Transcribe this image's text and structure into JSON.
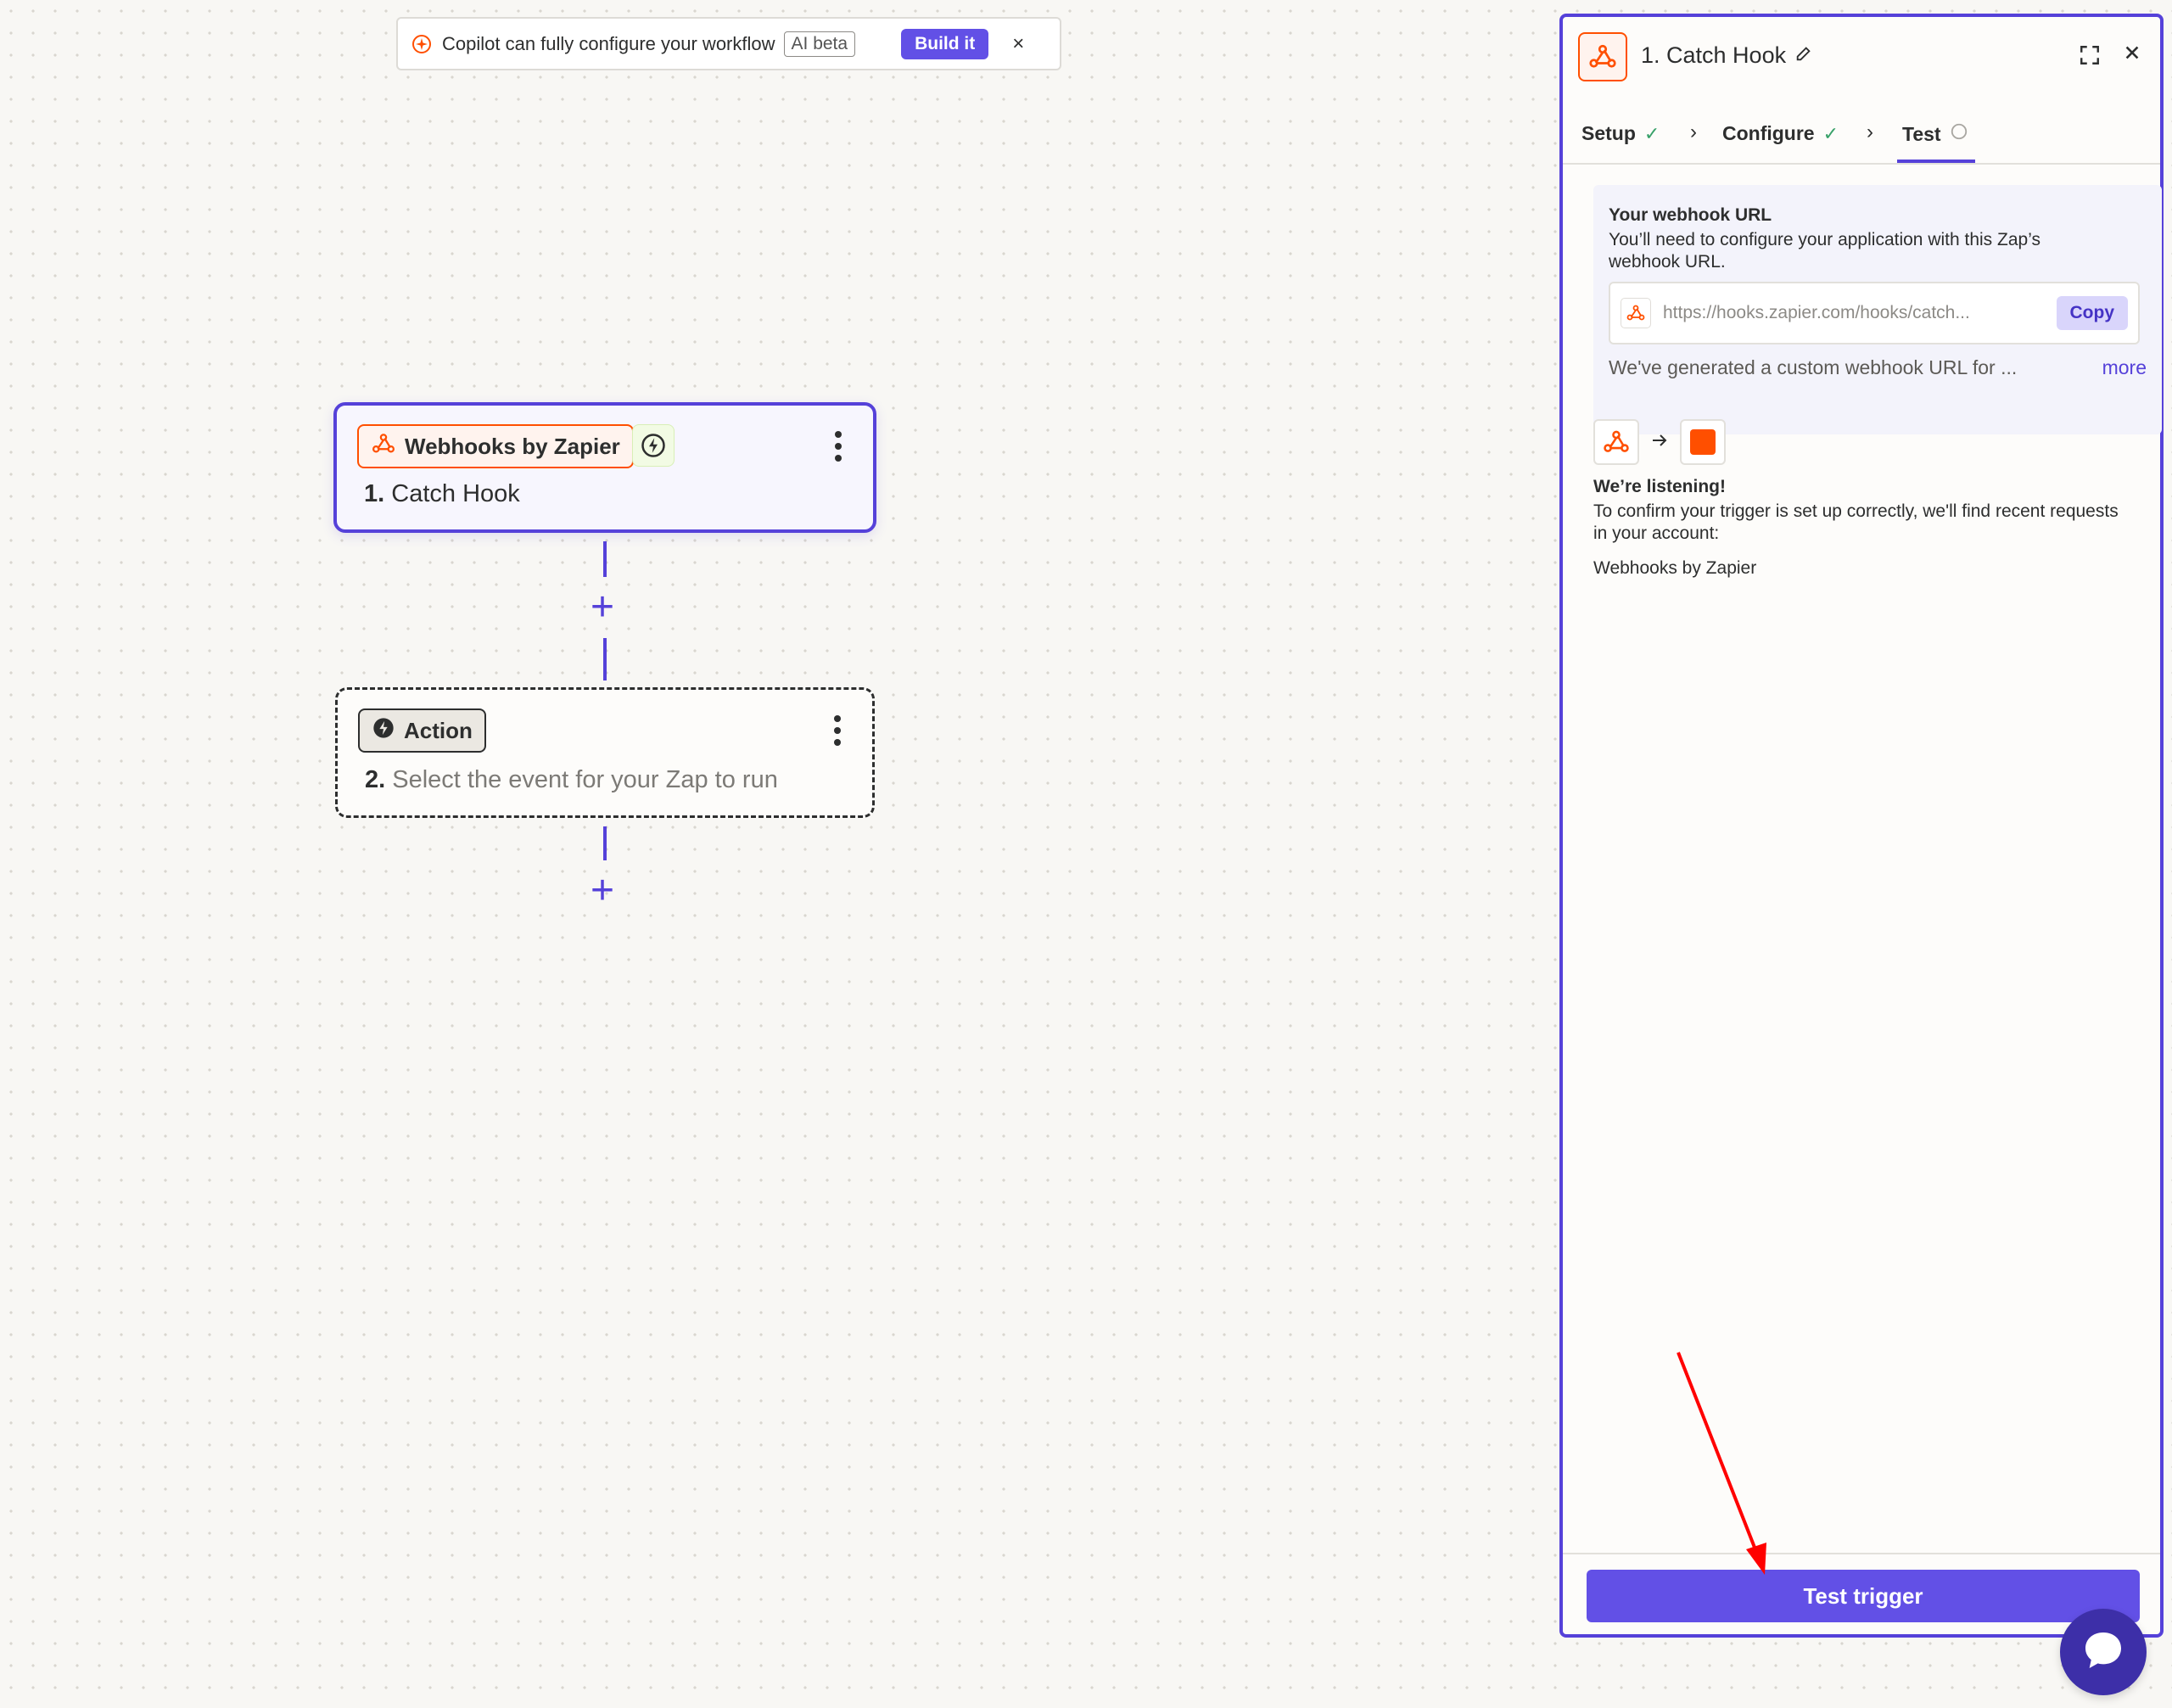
{
  "copilot": {
    "text": "Copilot can fully configure your workflow",
    "badge": "AI beta",
    "build_label": "Build it",
    "close_glyph": "×"
  },
  "canvas": {
    "trigger": {
      "app_label": "Webhooks by Zapier",
      "step_number": "1.",
      "step_title": "Catch Hook",
      "icon": "webhook-icon",
      "badge_icon": "lightning-icon"
    },
    "action": {
      "app_label": "Action",
      "step_number": "2.",
      "step_title": "Select the event for your Zap to run",
      "icon": "lightning-icon"
    },
    "plus_glyph": "+"
  },
  "panel": {
    "title": "1. Catch Hook",
    "tabs": [
      {
        "label": "Setup",
        "state": "complete"
      },
      {
        "label": "Configure",
        "state": "complete"
      },
      {
        "label": "Test",
        "state": "active"
      }
    ],
    "webhook": {
      "title": "Your webhook URL",
      "description": "You’ll need to configure your application with this Zap’s webhook URL.",
      "url": "https://hooks.zapier.com/hooks/catch...",
      "copy_label": "Copy",
      "generated_text": "We've generated a custom webhook URL for ...",
      "more_label": "more"
    },
    "listening": {
      "title": "We’re listening!",
      "description": "To confirm your trigger is set up correctly, we'll find recent requests in your account:",
      "app": "Webhooks by Zapier"
    },
    "test_trigger_label": "Test trigger"
  },
  "colors": {
    "accent": "#5541d9",
    "button": "#6250e6",
    "zapier_orange": "#ff4f00",
    "annotation_red": "#ff0000"
  }
}
